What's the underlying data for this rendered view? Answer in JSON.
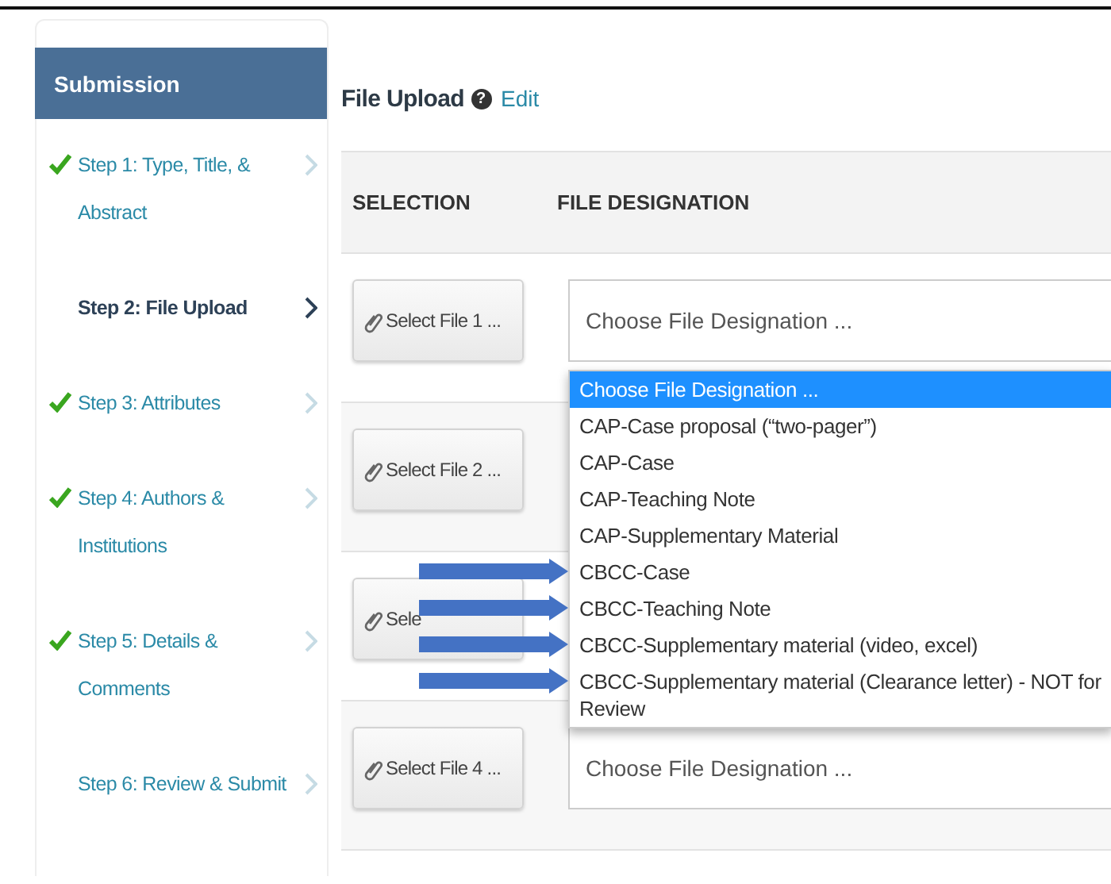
{
  "sidebar": {
    "title": "Submission",
    "items": [
      {
        "label": "Step 1: Type, Title, & Abstract",
        "done": true,
        "selected": false
      },
      {
        "label": "Step 2: File Upload",
        "done": false,
        "selected": true
      },
      {
        "label": "Step 3: Attributes",
        "done": true,
        "selected": false
      },
      {
        "label": "Step 4: Authors & Institutions",
        "done": true,
        "selected": false
      },
      {
        "label": "Step 5: Details & Comments",
        "done": true,
        "selected": false
      },
      {
        "label": "Step 6: Review & Submit",
        "done": false,
        "selected": false
      }
    ]
  },
  "main": {
    "title": "File Upload",
    "help": "?",
    "edit_link": "Edit",
    "table": {
      "columns": [
        "SELECTION",
        "FILE DESIGNATION"
      ],
      "rows": [
        {
          "button": "Select File 1 ...",
          "designation": "Choose File Designation ..."
        },
        {
          "button": "Select File 2 ..."
        },
        {
          "button": "Sele"
        },
        {
          "button": "Select File 4 ...",
          "designation": "Choose File Designation ..."
        }
      ]
    },
    "dropdown": {
      "options": [
        {
          "label": "Choose File Designation ...",
          "selected": true,
          "annotated": false
        },
        {
          "label": "CAP-Case proposal (“two-pager”)",
          "selected": false,
          "annotated": false
        },
        {
          "label": "CAP-Case",
          "selected": false,
          "annotated": false
        },
        {
          "label": "CAP-Teaching Note",
          "selected": false,
          "annotated": false
        },
        {
          "label": "CAP-Supplementary Material",
          "selected": false,
          "annotated": false
        },
        {
          "label": "CBCC-Case",
          "selected": false,
          "annotated": true
        },
        {
          "label": "CBCC-Teaching Note",
          "selected": false,
          "annotated": true
        },
        {
          "label": "CBCC-Supplementary material (video, excel)",
          "selected": false,
          "annotated": true
        },
        {
          "label": "CBCC-Supplementary material (Clearance letter) - NOT for Review",
          "selected": false,
          "annotated": true
        }
      ]
    }
  }
}
